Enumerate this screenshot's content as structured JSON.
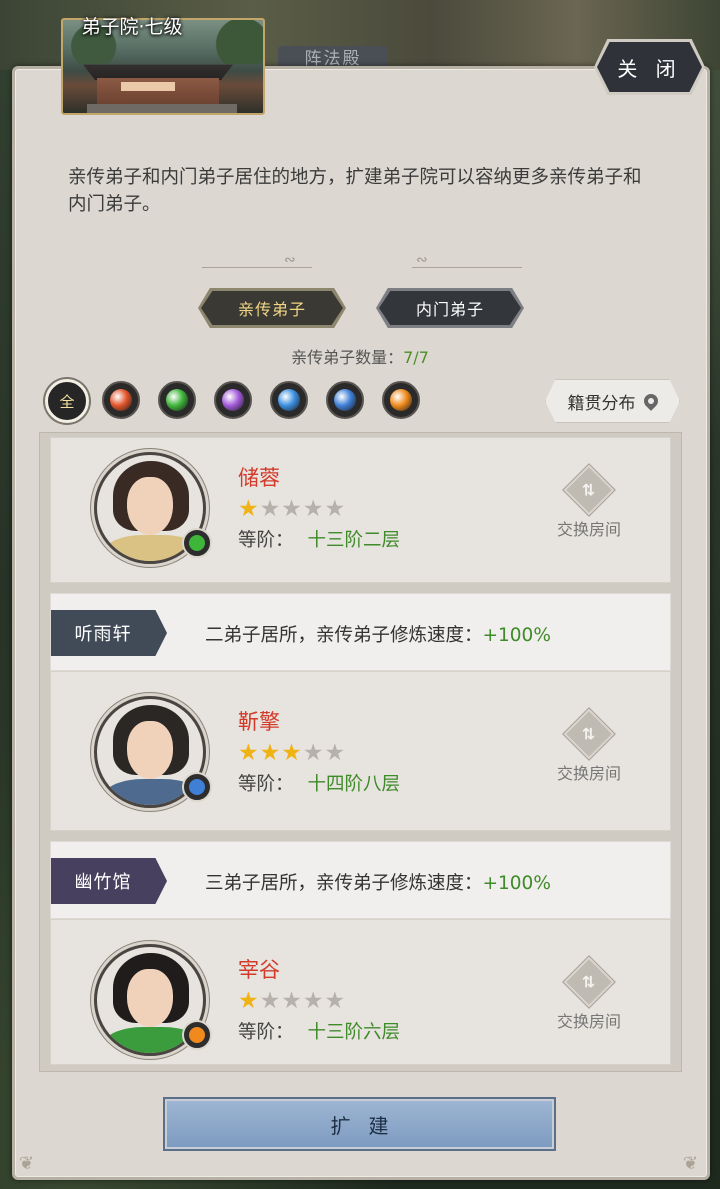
{
  "background": {
    "scene_tab": "阵法殿"
  },
  "header": {
    "title": "弟子院·七级",
    "close_label": "关 闭"
  },
  "description": "亲传弟子和内门弟子居住的地方，扩建弟子院可以容纳更多亲传弟子和内门弟子。",
  "tabs": [
    {
      "label": "亲传弟子",
      "active": true
    },
    {
      "label": "内门弟子",
      "active": false
    }
  ],
  "count": {
    "label": "亲传弟子数量：",
    "value": "7/7"
  },
  "filters": [
    {
      "label": "全",
      "icon": "all-icon",
      "color": "#f2e0a0"
    },
    {
      "icon": "sword-icon",
      "color": "#e2552a"
    },
    {
      "icon": "blade-icon",
      "color": "#3fb53a"
    },
    {
      "icon": "spear-icon",
      "color": "#a25ad8"
    },
    {
      "icon": "staff-icon",
      "color": "#3b8fe0"
    },
    {
      "icon": "fist-icon",
      "color": "#3f7fd6"
    },
    {
      "icon": "flame-icon",
      "color": "#f08a1c"
    }
  ],
  "origin_button": {
    "label": "籍贯分布",
    "icon": "location-pin-icon"
  },
  "disciples": [
    {
      "name": "储蓉",
      "stars": 1,
      "max_stars": 5,
      "rank_label": "等阶：",
      "rank": "十三阶二层",
      "badge_color": "#3fb53a",
      "hair_color": "#3a2a24",
      "body_color": "#d9c283",
      "swap_label": "交换房间"
    },
    {
      "room": {
        "name": "听雨轩",
        "desc": "二弟子居所，亲传弟子修炼速度：",
        "bonus": "+100%",
        "color": "#414a57"
      },
      "name": "靳擎",
      "stars": 3,
      "max_stars": 5,
      "rank_label": "等阶：",
      "rank": "十四阶八层",
      "badge_color": "#3f7fd6",
      "hair_color": "#2b2725",
      "body_color": "#4e6b8f",
      "swap_label": "交换房间"
    },
    {
      "room": {
        "name": "幽竹馆",
        "desc": "三弟子居所，亲传弟子修炼速度：",
        "bonus": "+100%",
        "color": "#47405e"
      },
      "name": "宰谷",
      "stars": 1,
      "max_stars": 5,
      "rank_label": "等阶：",
      "rank": "十三阶六层",
      "badge_color": "#f08a1c",
      "hair_color": "#1f1c1b",
      "body_color": "#3a9c3d",
      "swap_label": "交换房间"
    }
  ],
  "expand_button": {
    "label": "扩建"
  }
}
